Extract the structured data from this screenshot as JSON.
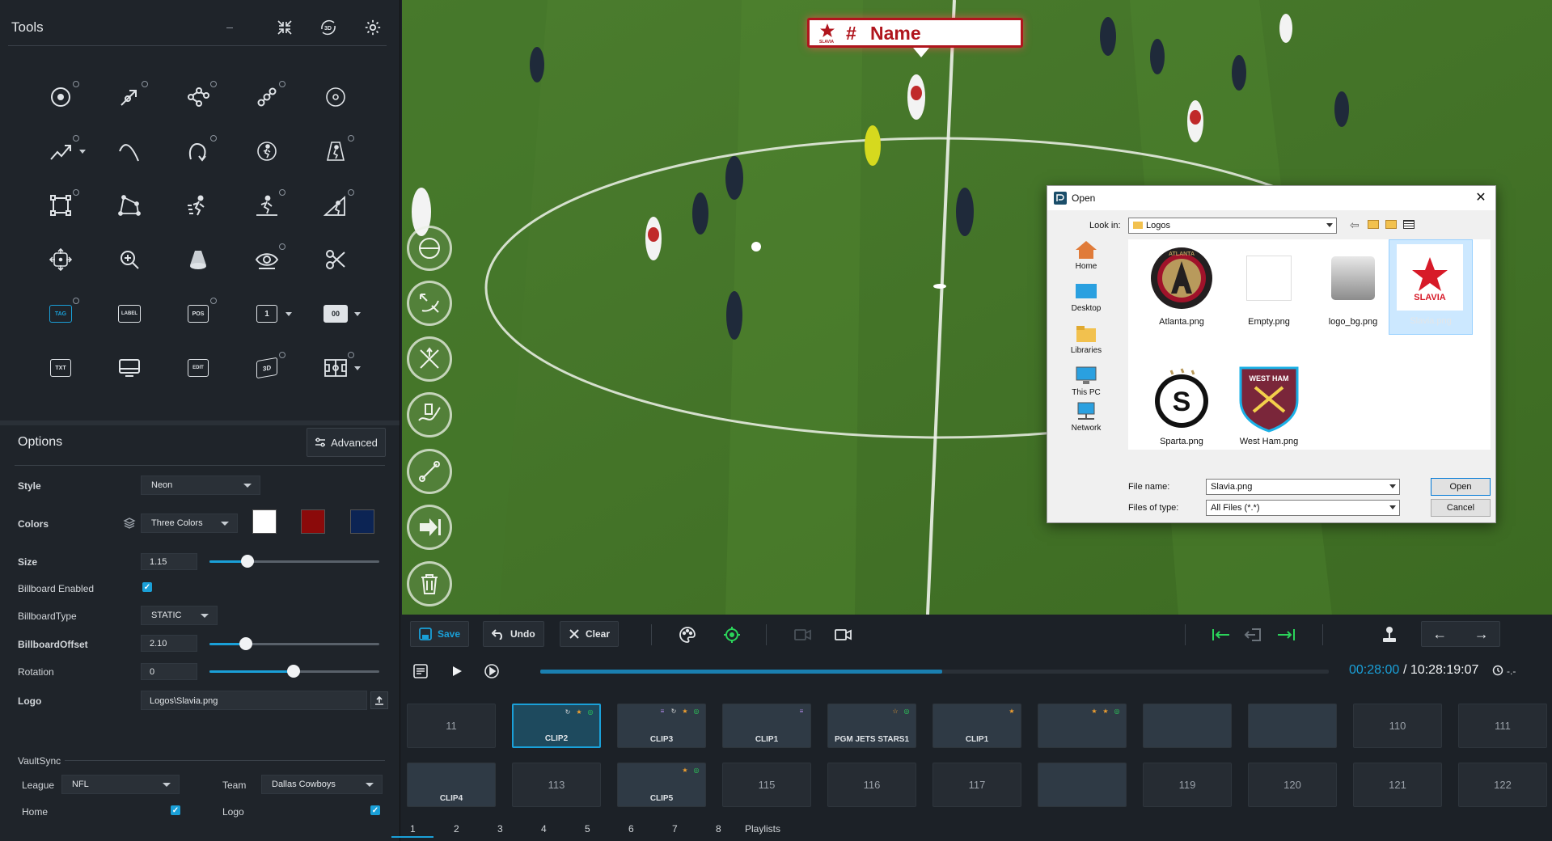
{
  "left_panel": {
    "title": "Tools",
    "header_icons": [
      "minimize-icon",
      "shrink-icon",
      "3d-rotate-icon",
      "gear-icon"
    ],
    "tools": [
      [
        "target-circle-icon",
        "arrow-pen-icon",
        "node-graph-icon",
        "link-icon",
        "ring-icon"
      ],
      [
        "trend-arrow-icon",
        "curve-line-icon",
        "curved-arrow-icon",
        "player-circle-icon",
        "spotlight-player-icon"
      ],
      [
        "square-select-icon",
        "polygon-icon",
        "sprint-icon",
        "player-cone-icon",
        "player-area-icon"
      ],
      [
        "move-crosshair-icon",
        "zoom-icon",
        "cone-icon",
        "eye-icon",
        "scissors-icon"
      ],
      [
        "tag-icon",
        "label-icon",
        "pos-icon",
        "number-badge-icon",
        "scoreboard-icon"
      ],
      [
        "txt-icon",
        "monitor-icon",
        "edit-icon",
        "3d-box-icon",
        "field-icon"
      ]
    ],
    "tool_texts": {
      "tag": "TAG",
      "label": "LABEL",
      "pos": "POS",
      "num": "1",
      "score": "00",
      "txt": "TXT",
      "edit": "EDIT",
      "three_d": "3D"
    },
    "options_title": "Options",
    "advanced_label": "Advanced",
    "style_label": "Style",
    "style_value": "Neon",
    "colors_label": "Colors",
    "colors_mode": "Three Colors",
    "colors": [
      "#ffffff",
      "#8b0a0a",
      "#0c2454"
    ],
    "size_label": "Size",
    "size_value": "1.15",
    "billboard_enabled_label": "Billboard Enabled",
    "billboard_type_label": "BillboardType",
    "billboard_type_value": "STATIC",
    "billboard_offset_label": "BillboardOffset",
    "billboard_offset_value": "2.10",
    "rotation_label": "Rotation",
    "rotation_value": "0",
    "logo_label": "Logo",
    "logo_value": "Logos\\Slavia.png",
    "vaultsync_title": "VaultSync",
    "league_label": "League",
    "league_value": "NFL",
    "team_label": "Team",
    "team_value": "Dallas Cowboys",
    "home_label": "Home",
    "logo_check_label": "Logo"
  },
  "billboard": {
    "hash": "#",
    "name": "Name",
    "club": "SLAVIA"
  },
  "dialog": {
    "title": "Open",
    "look_in_label": "Look in:",
    "look_in_value": "Logos",
    "places": [
      "Home",
      "Desktop",
      "Libraries",
      "This PC",
      "Network"
    ],
    "files": [
      {
        "name": "Atlanta.png",
        "badge": "ATLANTA"
      },
      {
        "name": "Empty.png",
        "badge": ""
      },
      {
        "name": "logo_bg.png",
        "badge": ""
      },
      {
        "name": "Slavia.png",
        "badge": "SLAVIA"
      },
      {
        "name": "Sparta.png",
        "badge": "S"
      },
      {
        "name": "West Ham.png",
        "badge": "WEST HAM"
      }
    ],
    "file_name_label": "File name:",
    "file_name_value": "Slavia.png",
    "files_of_type_label": "Files of type:",
    "files_of_type_value": "All Files (*.*)",
    "open_label": "Open",
    "cancel_label": "Cancel"
  },
  "toolbar": {
    "save_label": "Save",
    "undo_label": "Undo",
    "clear_label": "Clear"
  },
  "timeline": {
    "current": "00:28:00",
    "total": "/ 10:28:19:07",
    "rate": "-.-",
    "progress": 0.51
  },
  "clips_row1": [
    "11",
    "CLIP2",
    "CLIP3",
    "CLIP1",
    "PGM JETS STARS1",
    "CLIP1",
    "",
    "",
    "",
    "110",
    "111"
  ],
  "clips_row2": [
    "CLIP4",
    "113",
    "CLIP5",
    "115",
    "116",
    "117",
    "",
    "119",
    "120",
    "121",
    "122"
  ],
  "pages": [
    "1",
    "2",
    "3",
    "4",
    "5",
    "6",
    "7",
    "8",
    "Playlists"
  ]
}
